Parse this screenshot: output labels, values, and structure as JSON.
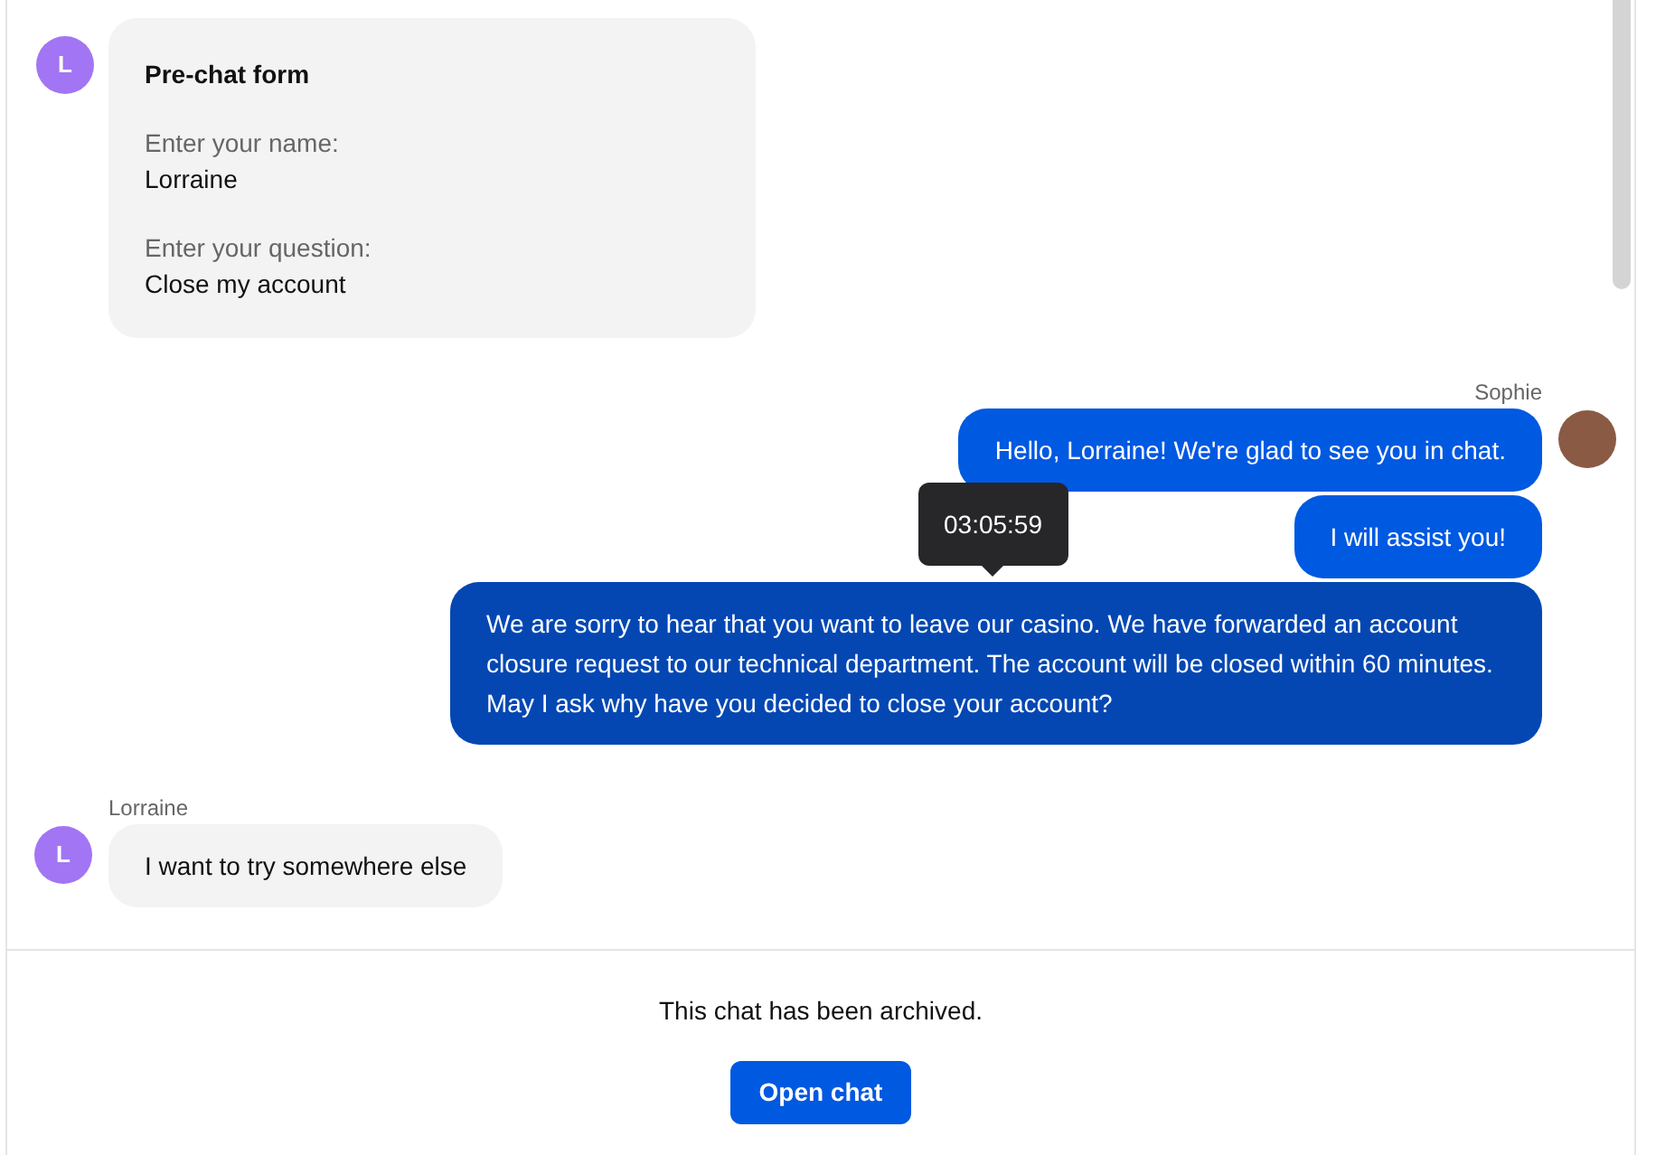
{
  "messages": [
    {
      "kind": "form",
      "avatar_initial": "L",
      "title": "Pre-chat form",
      "fields": [
        {
          "label": "Enter your name:",
          "value": "Lorraine"
        },
        {
          "label": "Enter your question:",
          "value": "Close my account"
        }
      ]
    },
    {
      "kind": "agent",
      "author": "Sophie",
      "bubbles": [
        {
          "text": "Hello, Lorraine! We're glad to see you in chat.",
          "highlighted": false
        },
        {
          "text": "I will assist you!",
          "highlighted": false
        },
        {
          "text": "We are sorry to hear that you want to leave our casino. We have forwarded an account closure request to our technical department. The account will be closed within 60 minutes. May I ask why have you decided to close your account?",
          "highlighted": true,
          "tooltip": "03:05:59"
        }
      ]
    },
    {
      "kind": "visitor",
      "author": "Lorraine",
      "avatar_initial": "L",
      "bubbles": [
        {
          "text": "I want to try somewhere else"
        }
      ]
    }
  ],
  "footer": {
    "notice": "This chat has been archived.",
    "button": "Open chat"
  }
}
